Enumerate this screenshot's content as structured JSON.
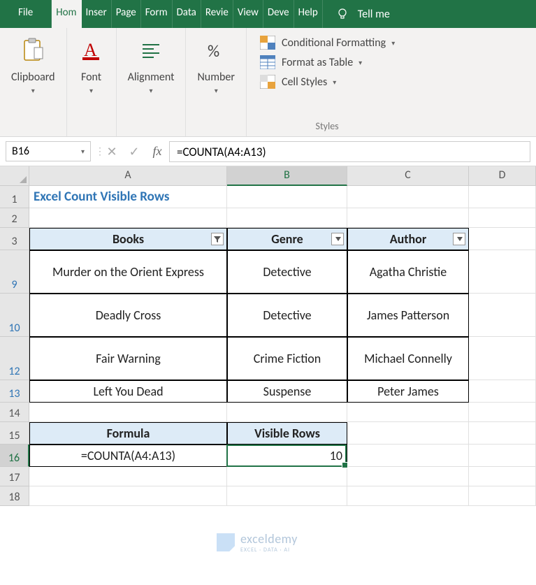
{
  "ribbon": {
    "tabs": [
      "File",
      "Hom",
      "Inser",
      "Page",
      "Form",
      "Data",
      "Revie",
      "View",
      "Deve",
      "Help"
    ],
    "active_tab": 1,
    "tell_me": "Tell me",
    "groups": {
      "clipboard": "Clipboard",
      "font": "Font",
      "alignment": "Alignment",
      "number": "Number",
      "styles": "Styles",
      "conditional": "Conditional Formatting",
      "format_table": "Format as Table",
      "cell_styles": "Cell Styles"
    }
  },
  "formula_bar": {
    "name_box": "B16",
    "formula": "=COUNTA(A4:A13)"
  },
  "columns": [
    "A",
    "B",
    "C",
    "D"
  ],
  "title": "Excel Count Visible Rows",
  "table": {
    "headers": {
      "a": "Books",
      "b": "Genre",
      "c": "Author"
    },
    "rows": [
      {
        "num": "9",
        "a": "Murder on the Orient Express",
        "b": "Detective",
        "c": "Agatha Christie"
      },
      {
        "num": "10",
        "a": "Deadly Cross",
        "b": "Detective",
        "c": "James Patterson"
      },
      {
        "num": "12",
        "a": "Fair Warning",
        "b": "Crime Fiction",
        "c": "Michael Connelly"
      },
      {
        "num": "13",
        "a": "Left You Dead",
        "b": "Suspense",
        "c": "Peter James"
      }
    ]
  },
  "summary": {
    "header_a": "Formula",
    "header_b": "Visible Rows",
    "formula": "=COUNTA(A4:A13)",
    "result": "10"
  },
  "plain_rows": {
    "r1": "1",
    "r2": "2",
    "r3": "3",
    "r14": "14",
    "r15": "15",
    "r16": "16",
    "r17": "17",
    "r18": "18"
  },
  "watermark": {
    "name": "exceldemy",
    "tag": "EXCEL · DATA · AI"
  }
}
